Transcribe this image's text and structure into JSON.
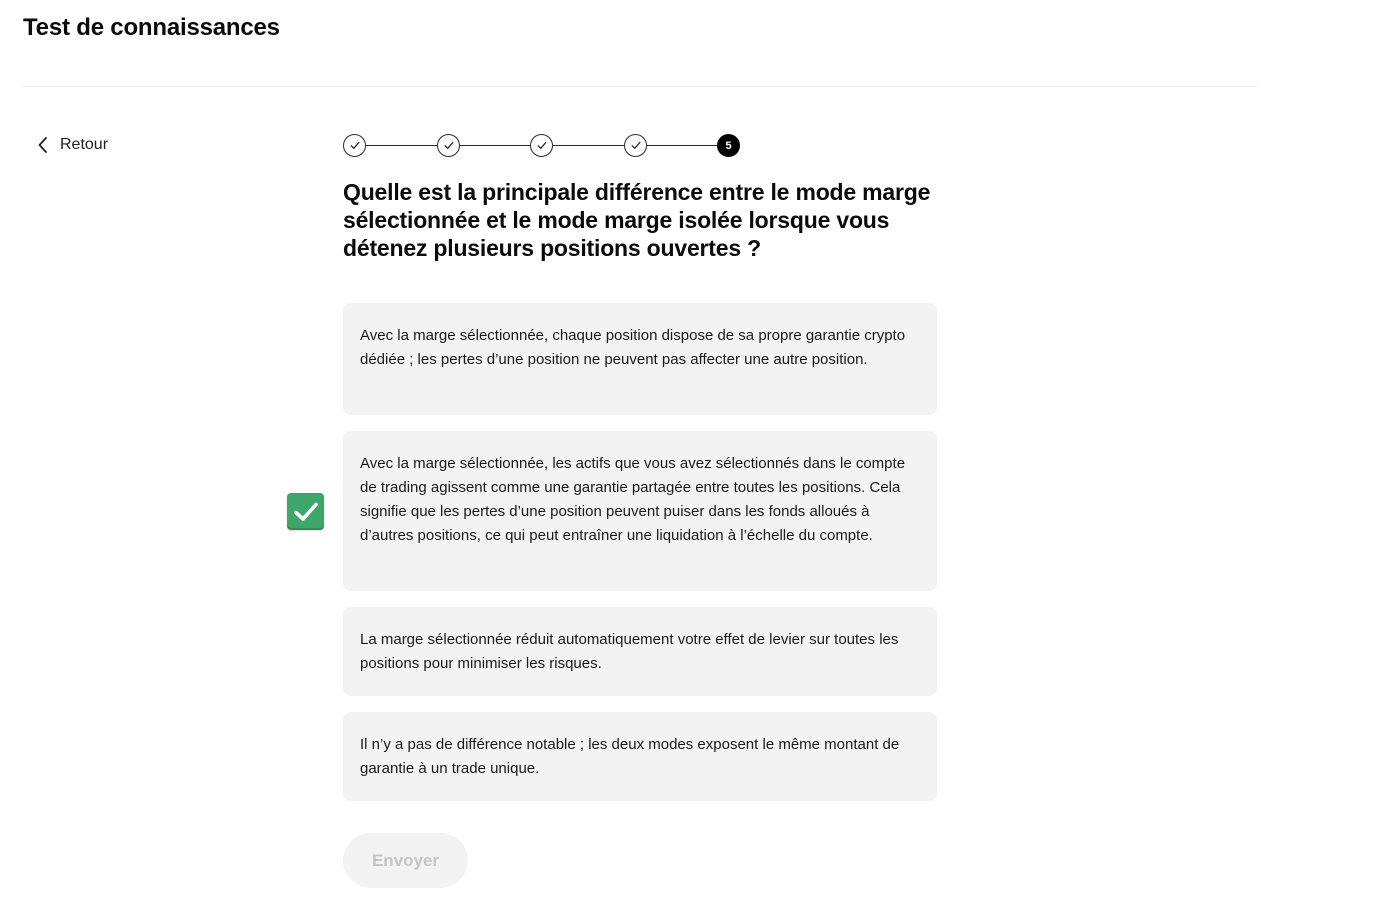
{
  "header": {
    "title": "Test de connaissances"
  },
  "nav": {
    "back_label": "Retour",
    "back_icon": "chevron-left-icon"
  },
  "progress": {
    "total_steps": 5,
    "current_step": 5,
    "current_step_label": "5",
    "completed_icon": "check-icon"
  },
  "question": {
    "text": "Quelle est la principale différence entre le mode marge sélectionnée et le mode marge isolée lorsque vous détenez plusieurs positions ouvertes ?"
  },
  "options": [
    {
      "text": "Avec la marge sélectionnée, chaque position dispose de sa propre garantie crypto dédiée ; les pertes d’une position ne peuvent pas affecter une autre position.",
      "selected": false
    },
    {
      "text": "Avec la marge sélectionnée, les actifs que vous avez sélectionnés dans le compte de trading agissent comme une garantie partagée entre toutes les positions. Cela signifie que les pertes d’une position peuvent puiser dans les fonds alloués à d’autres positions, ce qui peut entraîner une liquidation à l’échelle du compte.",
      "selected": true
    },
    {
      "text": "La marge sélectionnée réduit automatiquement votre effet de levier sur toutes les positions pour minimiser les risques.",
      "selected": false
    },
    {
      "text": "Il n’y a pas de différence notable ; les deux modes exposent le même montant de garantie à un trade unique.",
      "selected": false
    }
  ],
  "selection_marker": {
    "icon": "checkbox-checked-icon",
    "color": "#3ea66b"
  },
  "submit": {
    "label": "Envoyer",
    "disabled": true
  }
}
